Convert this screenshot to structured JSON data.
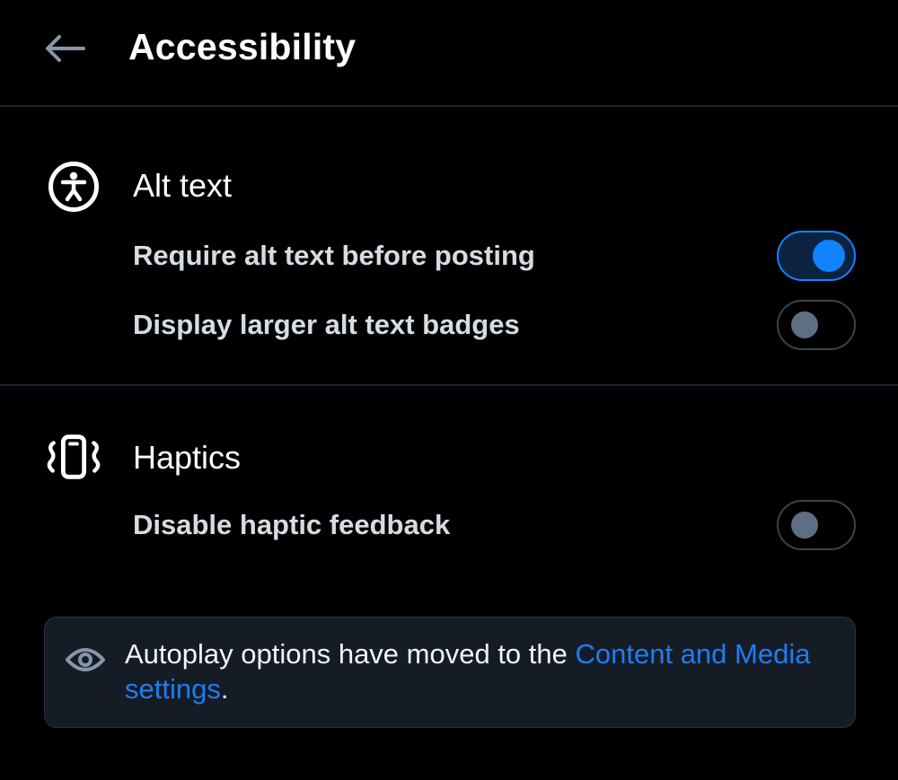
{
  "header": {
    "title": "Accessibility",
    "back_icon": "arrow-left-icon"
  },
  "sections": [
    {
      "title": "Alt text",
      "icon": "accessibility-person-icon",
      "options": [
        {
          "label": "Require alt text before posting",
          "enabled": true
        },
        {
          "label": "Display larger alt text badges",
          "enabled": false
        }
      ]
    },
    {
      "title": "Haptics",
      "icon": "phone-vibrate-icon",
      "options": [
        {
          "label": "Disable haptic feedback",
          "enabled": false
        }
      ]
    }
  ],
  "notice": {
    "icon": "eye-icon",
    "text_prefix": "Autoplay options have moved to the ",
    "link_text": "Content and Media settings",
    "text_suffix": "."
  },
  "colors": {
    "background": "#000000",
    "accent": "#1083fe",
    "link": "#1d7df2",
    "toggle_off_knob": "#5e6e85",
    "divider": "#1e2530",
    "notice_background": "#161c25"
  }
}
